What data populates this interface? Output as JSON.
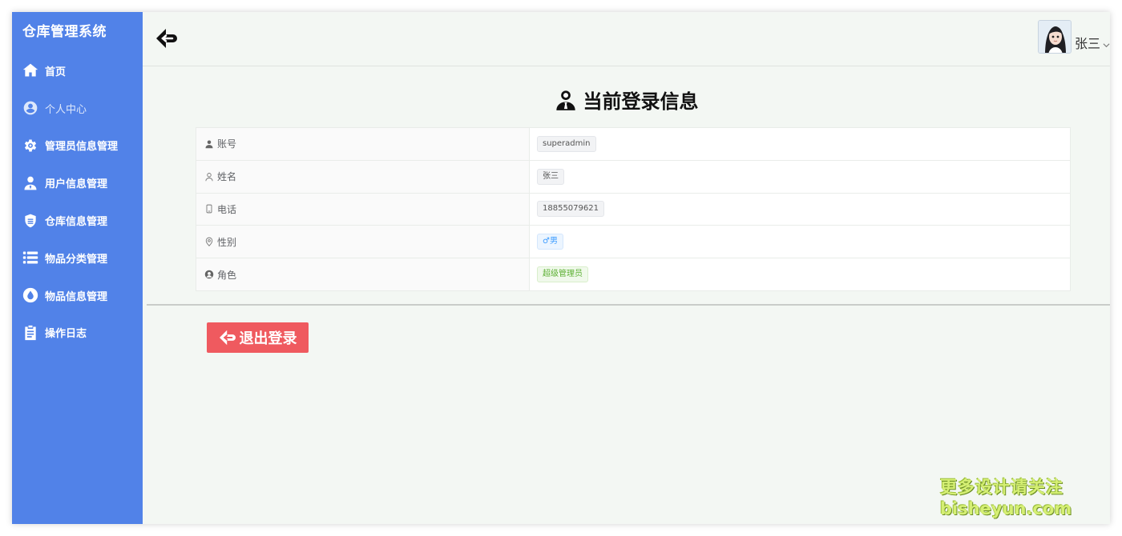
{
  "app": {
    "title": "仓库管理系统"
  },
  "sidebar": {
    "items": [
      {
        "label": "首页",
        "icon": "home-icon",
        "active": false
      },
      {
        "label": "个人中心",
        "icon": "user-circle-icon",
        "active": true
      },
      {
        "label": "管理员信息管理",
        "icon": "gear-icon",
        "active": false
      },
      {
        "label": "用户信息管理",
        "icon": "user-tie-icon",
        "active": false
      },
      {
        "label": "仓库信息管理",
        "icon": "shield-icon",
        "active": false
      },
      {
        "label": "物品分类管理",
        "icon": "list-icon",
        "active": false
      },
      {
        "label": "物品信息管理",
        "icon": "drop-icon",
        "active": false
      },
      {
        "label": "操作日志",
        "icon": "clipboard-icon",
        "active": false
      }
    ]
  },
  "header": {
    "user_name": "张三"
  },
  "main": {
    "title": "当前登录信息",
    "rows": [
      {
        "label": "账号",
        "icon": "user-solid-icon",
        "value": "superadmin",
        "tag": "default"
      },
      {
        "label": "姓名",
        "icon": "user-outline-icon",
        "value": "张三",
        "tag": "default"
      },
      {
        "label": "电话",
        "icon": "phone-icon",
        "value": "18855079621",
        "tag": "default"
      },
      {
        "label": "性别",
        "icon": "location-icon",
        "value": "♂男",
        "tag": "blue"
      },
      {
        "label": "角色",
        "icon": "role-icon",
        "value": "超级管理员",
        "tag": "green"
      }
    ],
    "logout_label": "退出登录"
  },
  "watermark": {
    "line1": "更多设计请关注",
    "line2": "bisheyun.com"
  },
  "colors": {
    "sidebar_bg": "#5182e8",
    "logout_bg": "#ef5a5f",
    "tag_blue": "#409eff",
    "tag_green": "#5cb033"
  }
}
